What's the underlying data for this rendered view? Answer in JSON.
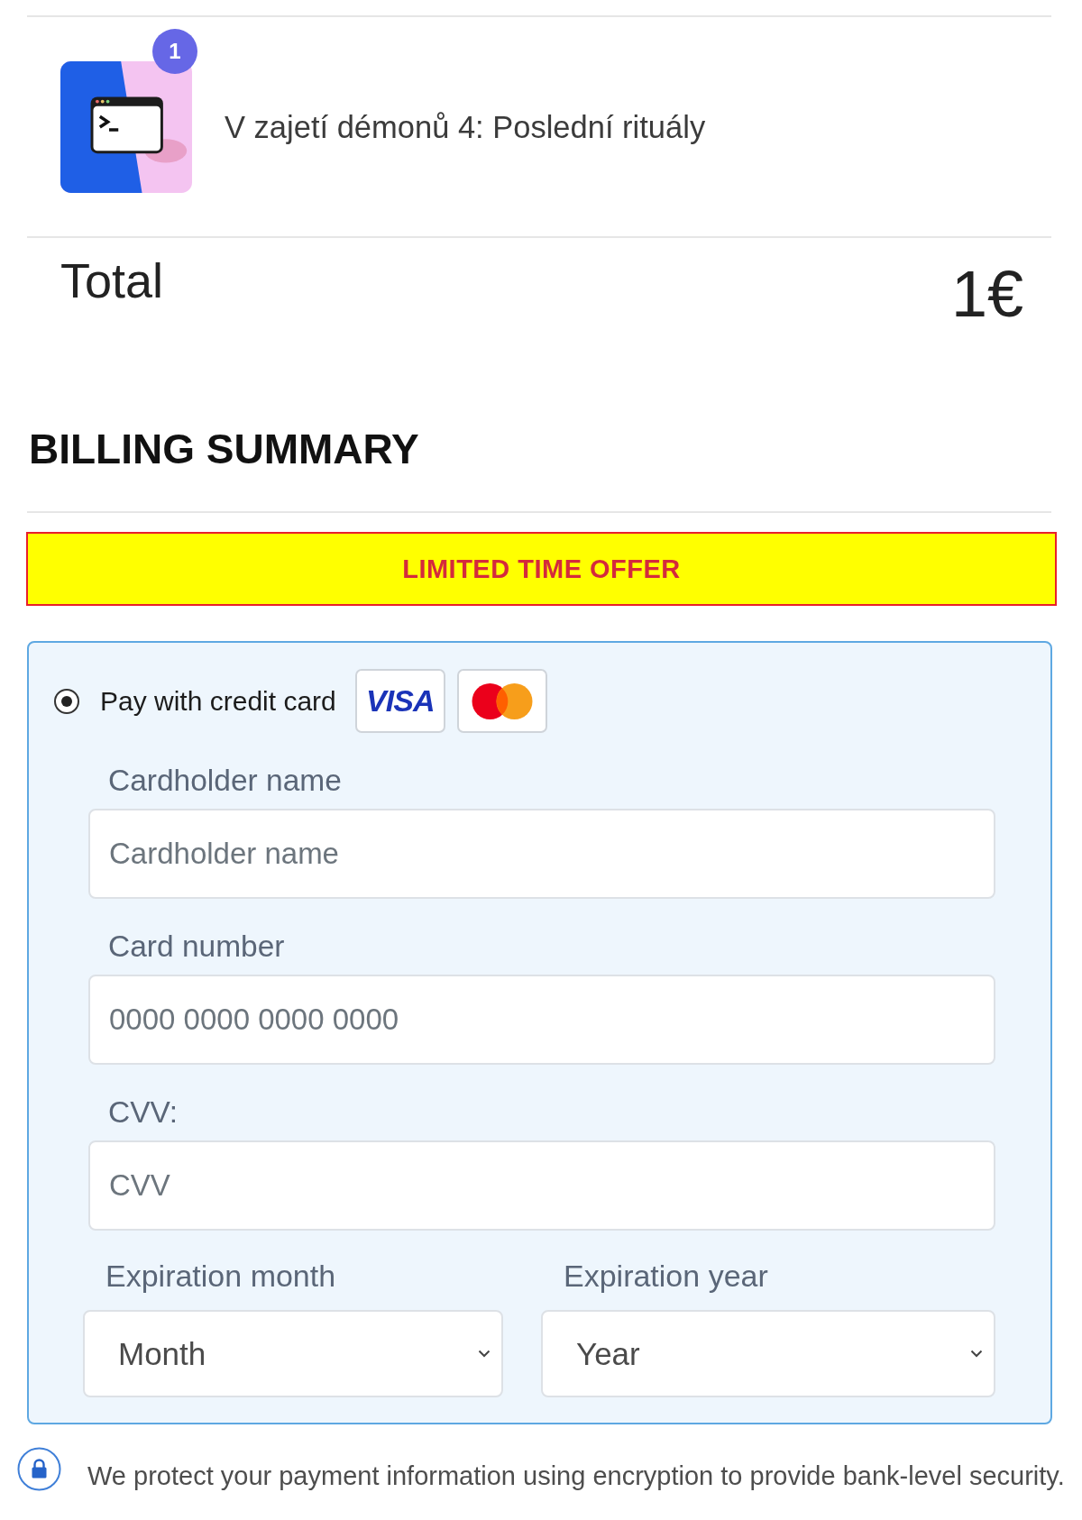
{
  "order": {
    "items": [
      {
        "title": "V zajetí démonů 4: Poslední rituály",
        "quantity": "1"
      }
    ]
  },
  "total": {
    "label": "Total",
    "amount": "1€"
  },
  "billing": {
    "heading": "BILLING SUMMARY",
    "offer_banner": "LIMITED TIME OFFER",
    "payment_methods": [
      {
        "label": "Pay with credit card",
        "selected": true,
        "card_logos": [
          {
            "kind": "wordmark",
            "text": "VISA"
          },
          {
            "kind": "circles"
          }
        ]
      }
    ],
    "fields": [
      {
        "label": "Cardholder name",
        "placeholder": "Cardholder name"
      },
      {
        "label": "Card number",
        "placeholder": "0000 0000 0000 0000"
      },
      {
        "label": "CVV:",
        "placeholder": "CVV"
      }
    ],
    "expiration": [
      {
        "label": "Expiration month",
        "value": "Month"
      },
      {
        "label": "Expiration year",
        "value": "Year"
      }
    ]
  },
  "security_note": "We protect your payment information using encryption to provide bank-level security."
}
